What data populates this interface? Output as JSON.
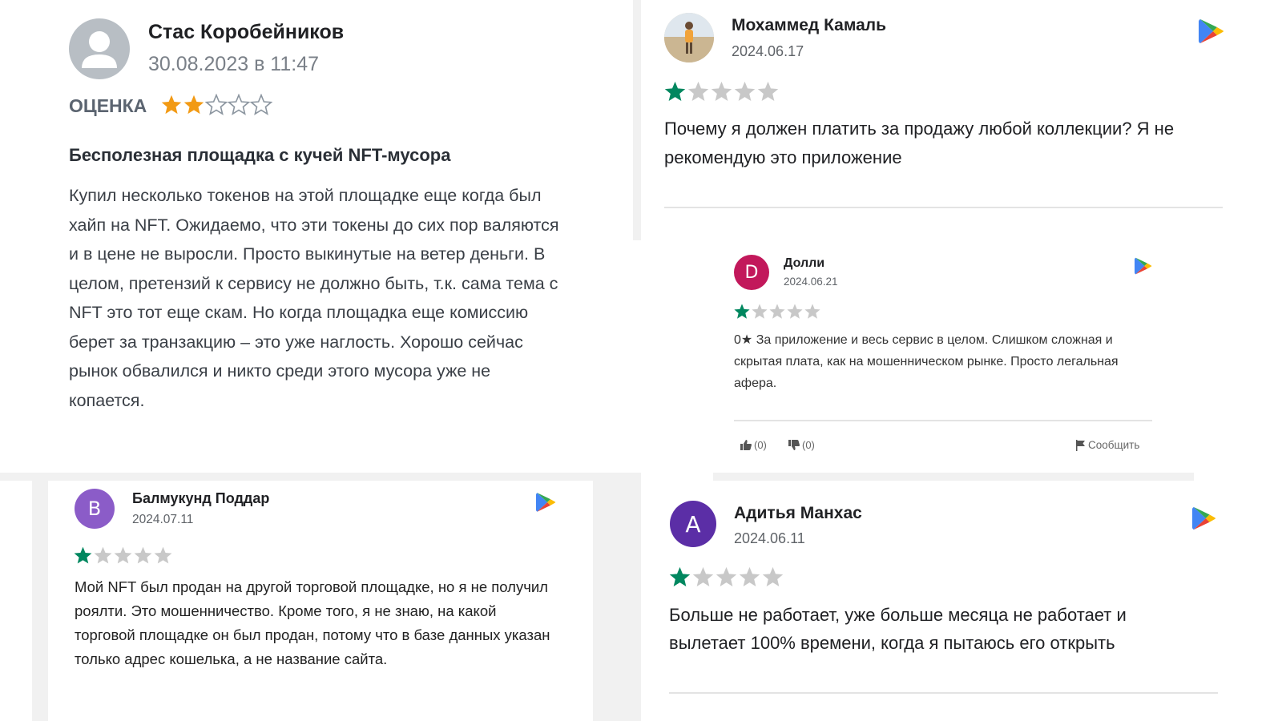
{
  "colors": {
    "star_green": "#01875f",
    "star_gray": "#c8c8c8",
    "star_orange": "#f29a14",
    "avatar_dolly": "#c2185b",
    "avatar_balmukund": "#8b5cc8",
    "avatar_aditya": "#5b2ea6"
  },
  "reviews": {
    "stas": {
      "name": "Стас Коробейников",
      "date": "30.08.2023 в 11:47",
      "rating_label": "ОЦЕНКА",
      "rating": 2,
      "max_rating": 5,
      "title": "Бесполезная площадка с кучей NFT-мусора",
      "text": "Купил несколько токенов на этой площадке еще когда был хайп на NFT. Ожидаемо, что эти токены до сих пор валяются и в цене не выросли. Просто выкинутые на ветер деньги. В целом, претензий к сервису не должно быть, т.к. сама тема с NFT это тот еще скам. Но когда площадка еще комиссию берет за транзакцию – это уже наглость. Хорошо сейчас рынок обвалился и никто среди этого мусора уже не копается."
    },
    "mohammed": {
      "name": "Мохаммед Камаль",
      "date": "2024.06.17",
      "rating": 1,
      "max_rating": 5,
      "text": "Почему я должен платить за продажу любой коллекции? Я не рекомендую это приложение"
    },
    "dolly": {
      "avatar_letter": "D",
      "name": "Долли",
      "date": "2024.06.21",
      "rating": 1,
      "max_rating": 5,
      "text": "0★ За приложение и весь сервис в целом. Слишком сложная и скрытая плата, как на мошенническом рынке. Просто легальная афера.",
      "likes": "(0)",
      "dislikes": "(0)",
      "report_label": "Сообщить"
    },
    "balmukund": {
      "avatar_letter": "B",
      "name": "Балмукунд Поддар",
      "date": "2024.07.11",
      "rating": 1,
      "max_rating": 5,
      "text": "Мой NFT был продан на другой торговой площадке, но я не получил роялти. Это мошенничество. Кроме того, я не знаю, на какой торговой площадке он был продан, потому что в базе данных указан только адрес кошелька, а не название сайта."
    },
    "aditya": {
      "avatar_letter": "A",
      "name": "Адитья Манхас",
      "date": "2024.06.11",
      "rating": 1,
      "max_rating": 5,
      "text": "Больше не работает, уже больше месяца не работает и вылетает 100% времени, когда я пытаюсь его открыть"
    }
  }
}
